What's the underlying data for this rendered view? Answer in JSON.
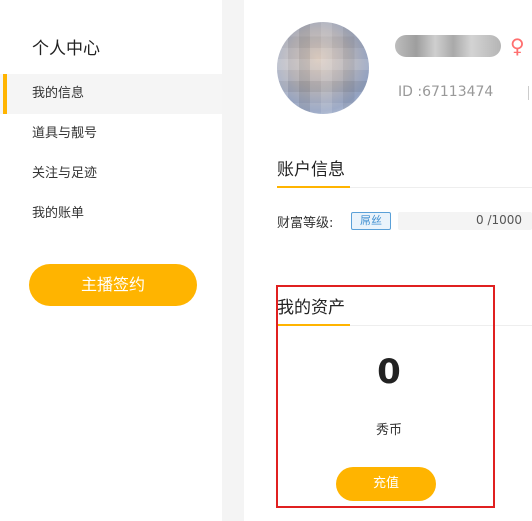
{
  "sidebar": {
    "title": "个人中心",
    "items": [
      {
        "label": "我的信息",
        "active": true
      },
      {
        "label": "道具与靓号",
        "active": false
      },
      {
        "label": "关注与足迹",
        "active": false
      },
      {
        "label": "我的账单",
        "active": false
      }
    ],
    "sign_button": "主播签约"
  },
  "profile": {
    "gender_icon": "♀",
    "user_id": "ID :67113474"
  },
  "account_info": {
    "title": "账户信息",
    "wealth_label": "财富等级:",
    "wealth_badge": "屌丝",
    "progress_text": "0 /1000",
    "progress_fraction": 0
  },
  "assets": {
    "title": "我的资产",
    "amount": "0",
    "unit": "秀币",
    "recharge_button": "充值"
  },
  "colors": {
    "accent": "#ffb400",
    "female": "#ff6f6f",
    "highlight": "#e02020",
    "badge": "#3e8ed0"
  }
}
